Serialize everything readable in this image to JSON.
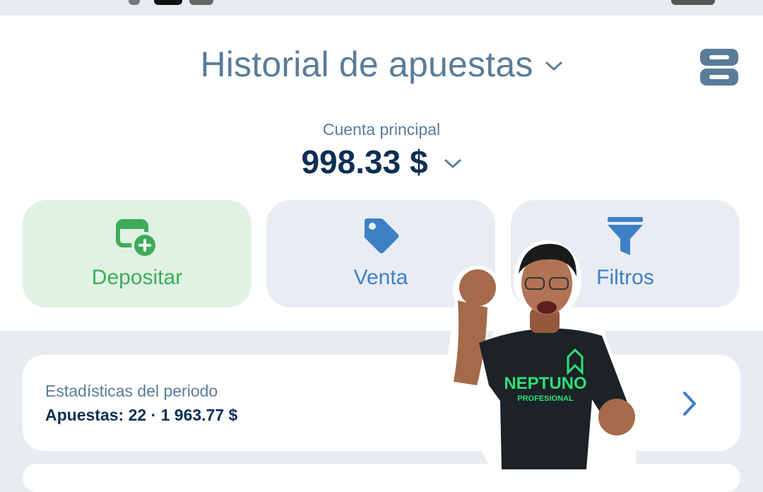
{
  "header": {
    "title": "Historial de apuestas",
    "menu_icon": "menu-icon"
  },
  "account": {
    "label": "Cuenta principal",
    "balance": "998.33 $"
  },
  "actions": [
    {
      "label": "Depositar",
      "icon": "deposit-add-icon",
      "color": "#3fab5a"
    },
    {
      "label": "Venta",
      "icon": "tag-icon",
      "color": "#3e80c5"
    },
    {
      "label": "Filtros",
      "icon": "filter-icon",
      "color": "#3e80c5"
    }
  ],
  "stats": {
    "title": "Estadísticas del periodo",
    "value": "Apuestas: 22 · 1 963.77 $"
  },
  "overlay": {
    "shirt_text": "NEPTUNO",
    "shirt_subtext": "PROFESIONAL"
  },
  "colors": {
    "background": "#e8ebf0",
    "card": "#ffffff",
    "title": "#5a7c99",
    "balance": "#0e2f55",
    "accent_green": "#3fab5a",
    "accent_blue": "#3e80c5"
  }
}
